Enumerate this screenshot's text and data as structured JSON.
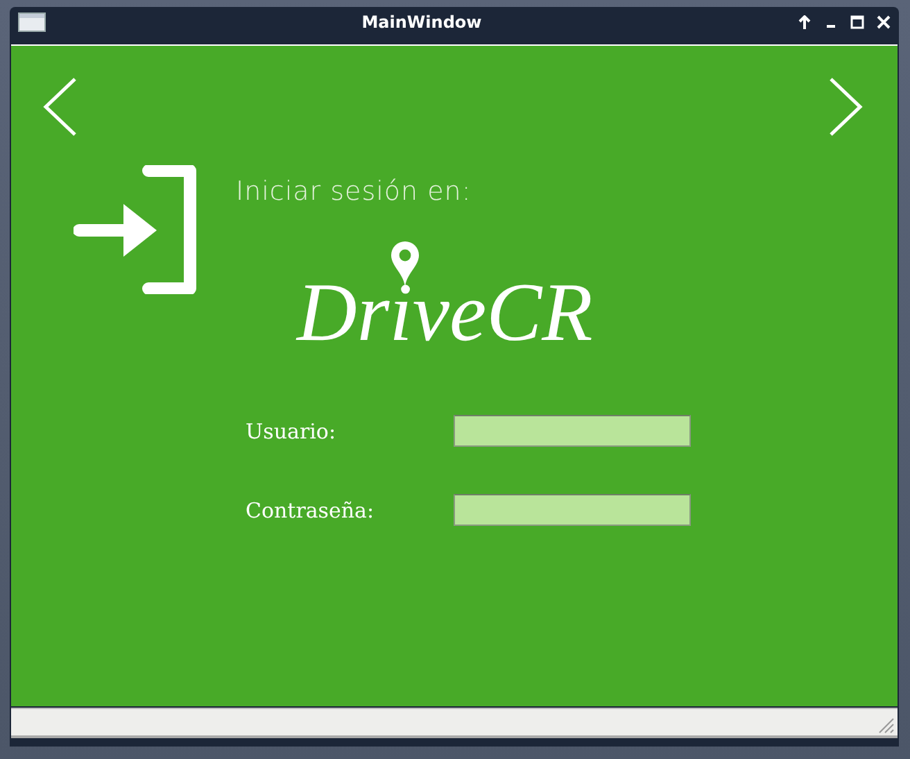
{
  "window": {
    "title": "MainWindow"
  },
  "heading": "Iniciar sesión en:",
  "logo": "DriveCR",
  "fields": [
    {
      "label": "Usuario:"
    },
    {
      "label": "Contraseña:"
    }
  ]
}
